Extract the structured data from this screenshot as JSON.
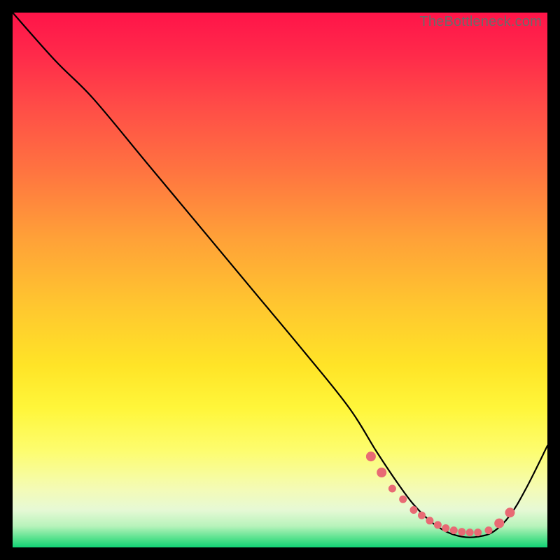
{
  "watermark": "TheBottleneck.com",
  "colors": {
    "page_bg": "#000000",
    "curve": "#000000",
    "dots": "#e86a74"
  },
  "chart_data": {
    "type": "line",
    "title": "",
    "xlabel": "",
    "ylabel": "",
    "xlim": [
      0,
      100
    ],
    "ylim": [
      0,
      100
    ],
    "grid": false,
    "legend": false,
    "series": [
      {
        "name": "bottleneck-curve",
        "x": [
          0,
          8,
          15,
          25,
          35,
          45,
          55,
          63,
          68,
          72,
          75,
          78,
          81,
          84,
          87,
          90,
          93,
          96,
          100
        ],
        "y": [
          100,
          91,
          84,
          72,
          60,
          48,
          36,
          26,
          18,
          12,
          8,
          5,
          3,
          2,
          2,
          3,
          6,
          11,
          19
        ]
      }
    ],
    "highlight_points": {
      "name": "bottom-cluster",
      "x": [
        67,
        69,
        71,
        73,
        75,
        76.5,
        78,
        79.5,
        81,
        82.5,
        84,
        85.5,
        87,
        89,
        91,
        93
      ],
      "y": [
        17,
        14,
        11,
        9,
        7,
        6,
        5,
        4.2,
        3.6,
        3.2,
        2.9,
        2.8,
        2.8,
        3.2,
        4.5,
        6.5
      ]
    }
  }
}
